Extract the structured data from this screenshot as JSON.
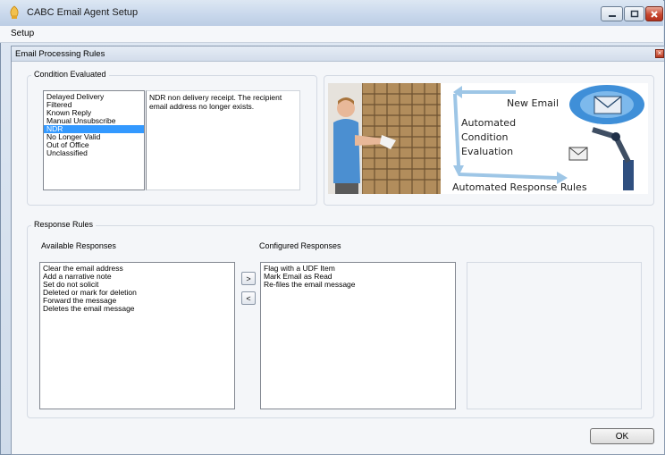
{
  "window": {
    "title": "CABC Email Agent Setup",
    "menu": [
      "Setup"
    ]
  },
  "child": {
    "title": "Email Processing Rules"
  },
  "condition": {
    "group_label": "Condition Evaluated",
    "items": [
      "Delayed Delivery",
      "Filtered",
      "Known Reply",
      "Manual Unsubscribe",
      "NDR",
      "No Longer Valid",
      "Out of Office",
      "Unclassified"
    ],
    "selected": "NDR",
    "description": "NDR non delivery receipt.   The recipient email address no longer exists."
  },
  "graphic": {
    "new_email": "New Email",
    "automated": "Automated",
    "condition": "Condition",
    "evaluation": "Evaluation",
    "response_rules": "Automated Response Rules"
  },
  "response": {
    "group_label": "Response Rules",
    "available_label": "Available Responses",
    "configured_label": "Configured Responses",
    "available": [
      "Clear the email address",
      "Add a narrative note",
      "Set do not solicit",
      "Deleted or mark for deletion",
      "Forward the message",
      "Deletes the email message"
    ],
    "configured": [
      "Flag with a UDF Item",
      "Mark Email as Read",
      "Re-files the email message"
    ],
    "add_label": ">",
    "remove_label": "<"
  },
  "ok_label": "OK",
  "colors": {
    "selection": "#3399ff",
    "close_button": "#c8472f"
  }
}
